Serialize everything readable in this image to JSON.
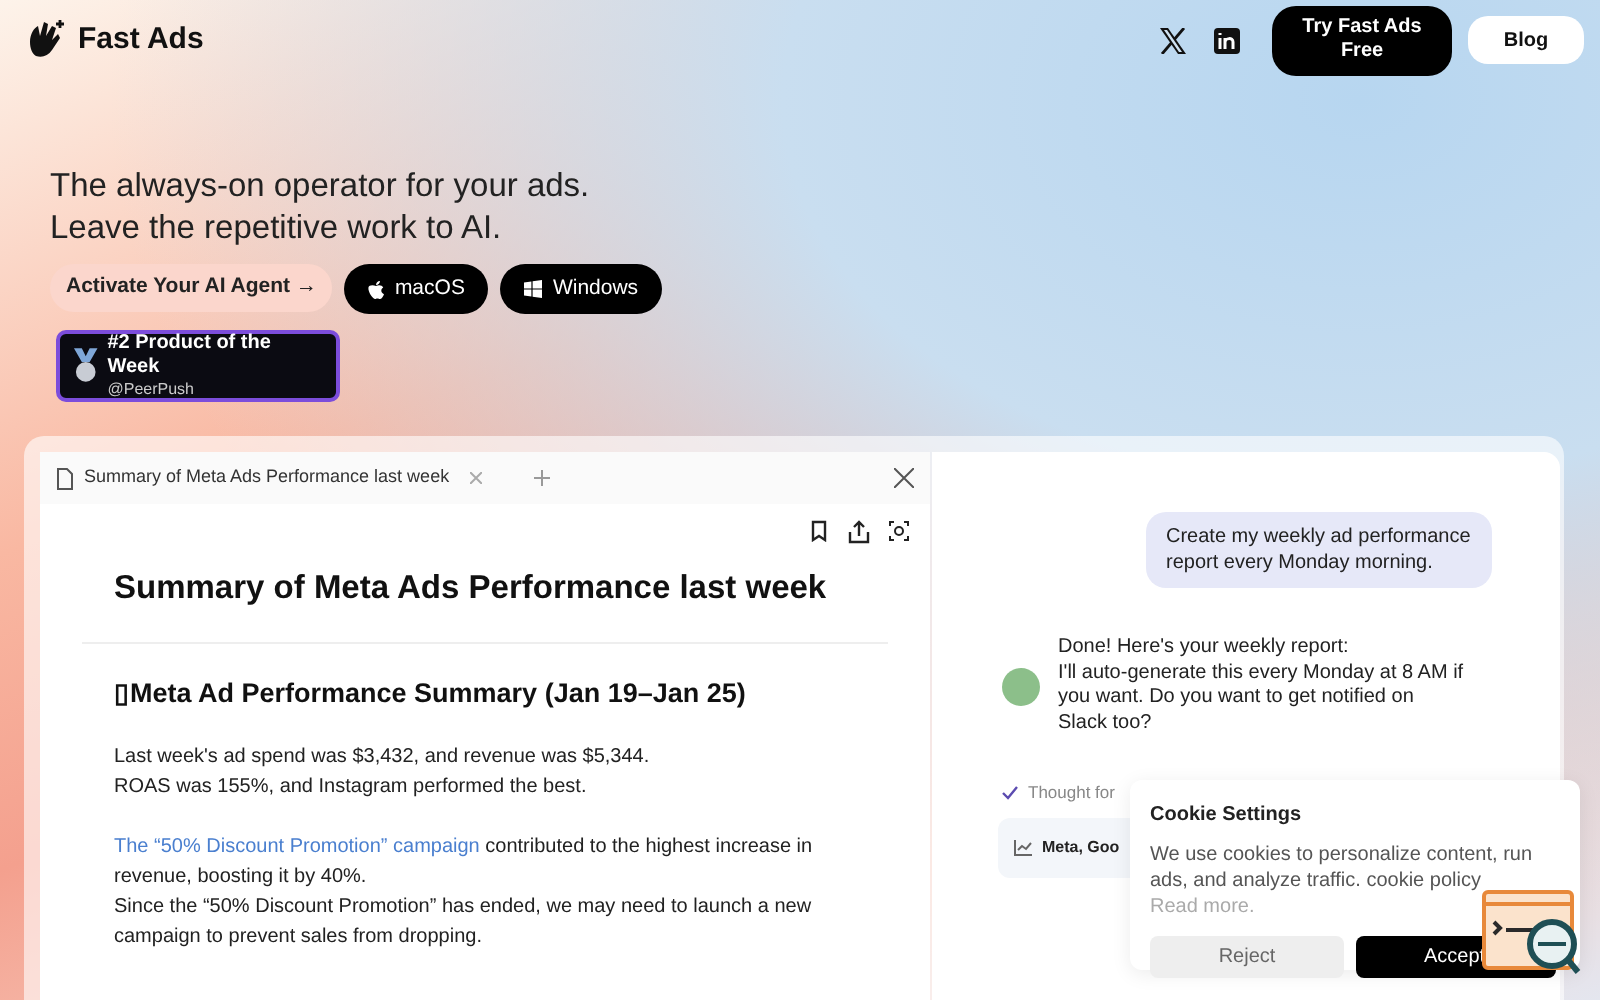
{
  "header": {
    "brand": "Fast Ads",
    "nav": [
      {
        "kind": "x"
      },
      {
        "kind": "linkedin"
      }
    ],
    "buttons": [
      {
        "label": "Try Fast Ads Free",
        "kind": "primary"
      },
      {
        "label": "Blog",
        "kind": "secondary"
      }
    ]
  },
  "hero": {
    "lines": [
      "The always-on operator for your ads.",
      "Leave the repetitive work to AI."
    ],
    "buttons": [
      {
        "label": "Activate Your AI Agent →",
        "kind": "light"
      },
      {
        "label": "macOS",
        "kind": "apple"
      },
      {
        "label": "Windows",
        "kind": "windows"
      }
    ],
    "badge": {
      "title": "#2 Product of the Week",
      "subtitle": "@PeerPush"
    }
  },
  "document": {
    "tab": "Summary of Meta Ads Performance last week",
    "title": "Summary of Meta Ads Performance last week",
    "heading": "▯Meta Ad Performance Summary (Jan 19–Jan 25)",
    "paragraphs": [
      {
        "lines": [
          "Last week's ad spend was $3,432, and revenue was $5,344.",
          "ROAS was 155%, and Instagram performed the best."
        ]
      },
      {
        "link": "The “50% Discount Promotion” campaign",
        "lines": [
          " contributed to the highest increase in revenue, boosting it by 40%.",
          "Since the “50% Discount Promotion” has ended, we may need to launch a new campaign to prevent sales from dropping."
        ]
      }
    ]
  },
  "chat": {
    "user_message": "Create my weekly ad performance report every Monday morning.",
    "agent_message": [
      "Done! Here's your weekly report:",
      "I'll auto-generate this every Monday at 8 AM if you want. Do you want to get notified on Slack too?"
    ],
    "thought": "Thought for",
    "source": "Meta, Goo"
  },
  "cookie": {
    "title": "Cookie Settings",
    "text": "We use cookies to personalize content, run ads, and analyze traffic. cookie policy",
    "link": "Read more.",
    "buttons": [
      {
        "label": "Reject",
        "kind": "reject"
      },
      {
        "label": "Accept",
        "kind": "accept"
      }
    ]
  }
}
